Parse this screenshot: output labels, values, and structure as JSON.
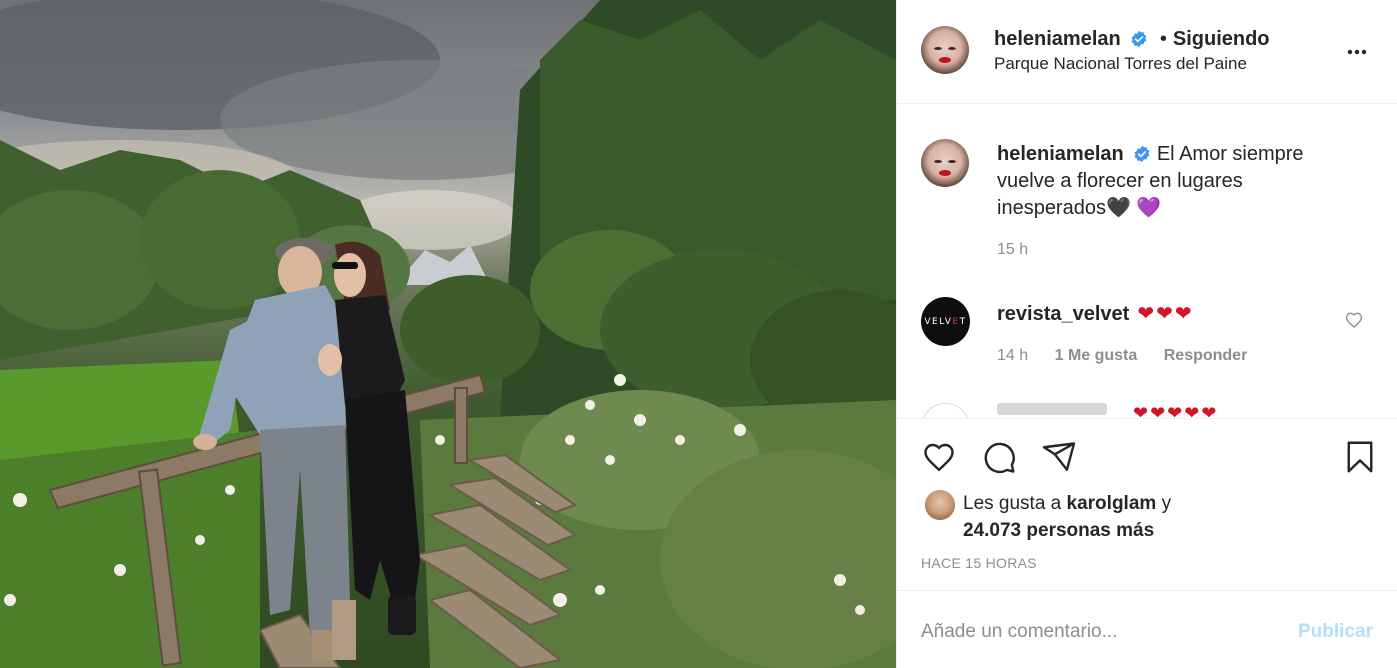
{
  "post": {
    "photo_alt": "",
    "header": {
      "username": "heleniamelan",
      "separator": "•",
      "follow_status": "Siguiendo",
      "location": "Parque Nacional Torres del Paine"
    },
    "caption": {
      "username": "heleniamelan",
      "text": "El Amor siempre vuelve a florecer en lugares inesperados",
      "emojis": "🖤 💜",
      "time": "15 h"
    },
    "comments": [
      {
        "username": "revista_velvet",
        "avatar_text_a": "VELV",
        "avatar_text_b": "E",
        "avatar_text_c": "T",
        "hearts": "❤❤❤",
        "time": "14 h",
        "likes": "1 Me gusta",
        "reply_label": "Responder"
      }
    ],
    "next_comment_hearts": "❤❤❤❤❤",
    "likes": {
      "prefix": "Les gusta a",
      "first_user": "karolglam",
      "connector": "y",
      "others": "24.073 personas más"
    },
    "time_ago": "HACE 15 HORAS",
    "comment_box": {
      "placeholder": "Añade un comentario...",
      "publish_label": "Publicar"
    },
    "colors": {
      "verified": "#3897f0",
      "publish_disabled": "#b2dffc",
      "heart": "#d3142b",
      "secondary_text": "#8e8e8e"
    }
  }
}
